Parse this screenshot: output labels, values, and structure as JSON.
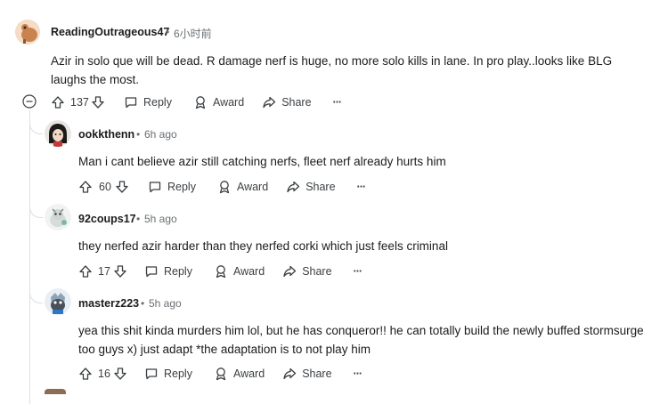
{
  "comments": [
    {
      "username": "ReadingOutrageous47",
      "time": "6小时前",
      "body": "Azir in solo que will be dead. R damage nerf is huge, no more solo kills in lane. In pro play..looks like BLG laughs the most.",
      "votes": "137",
      "reply": "Reply",
      "award": "Award",
      "share": "Share",
      "more": "···"
    },
    {
      "username": "ookkthenn",
      "time": "6h ago",
      "body": "Man i cant believe azir still catching nerfs, fleet nerf already hurts him",
      "votes": "60",
      "reply": "Reply",
      "award": "Award",
      "share": "Share",
      "more": "···"
    },
    {
      "username": "92coups17",
      "time": "5h ago",
      "body": "they nerfed azir harder than they nerfed corki which just feels criminal",
      "votes": "17",
      "reply": "Reply",
      "award": "Award",
      "share": "Share",
      "more": "···"
    },
    {
      "username": "masterz223",
      "time": "5h ago",
      "body": "yea this shit kinda murders him lol, but he has conqueror!! he can totally build the newly buffed stormsurge too guys x) just adapt *the adaptation is to not play him",
      "votes": "16",
      "reply": "Reply",
      "award": "Award",
      "share": "Share",
      "more": "···"
    }
  ],
  "separator": "•",
  "colors": {
    "thread_line": "#dcdfe2",
    "meta_text": "#6a6f73",
    "icon": "#3b3f42"
  }
}
